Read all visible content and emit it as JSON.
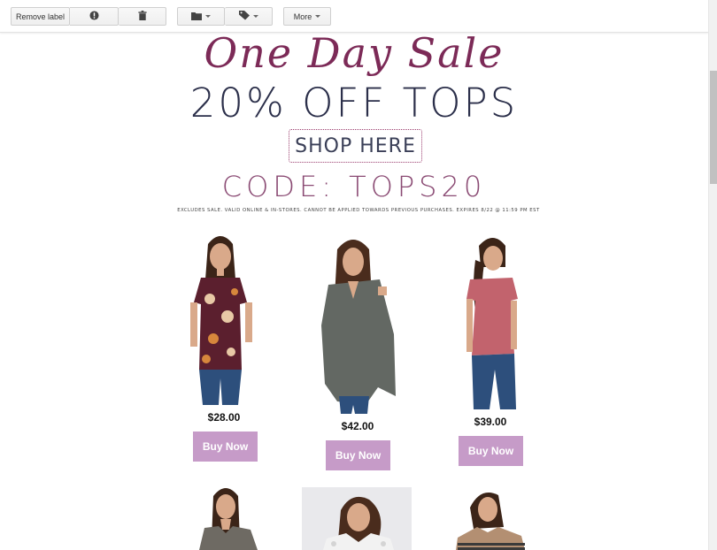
{
  "toolbar": {
    "remove_label": "Remove label",
    "spam_icon": "report-spam-icon",
    "delete_icon": "trash-icon",
    "move_icon": "folder-icon",
    "labels_icon": "tag-icon",
    "more_label": "More"
  },
  "email": {
    "script_title": "One Day Sale",
    "headline": "20% OFF TOPS",
    "cta": "SHOP HERE",
    "code": "CODE: TOPS20",
    "fine_print": "EXCLUDES SALE. VALID ONLINE & IN-STORES. CANNOT BE APPLIED TOWARDS PREVIOUS PURCHASES. EXPIRES 8/22 @ 11:59 PM EST",
    "colors": {
      "accent": "#7c2a57",
      "button": "#c69bc8",
      "headline": "#2b2f4a"
    }
  },
  "products": [
    {
      "price": "$28.00",
      "button": "Buy Now",
      "top_color": "#5b1f2e"
    },
    {
      "price": "$42.00",
      "button": "Buy Now",
      "top_color": "#636863"
    },
    {
      "price": "$39.00",
      "button": "Buy Now",
      "top_color": "#c2636d"
    }
  ],
  "products_row2": [
    {
      "top_color": "#6e6a63"
    },
    {
      "top_color": "#f2f2f2"
    },
    {
      "top_color": "#b38f72"
    }
  ]
}
